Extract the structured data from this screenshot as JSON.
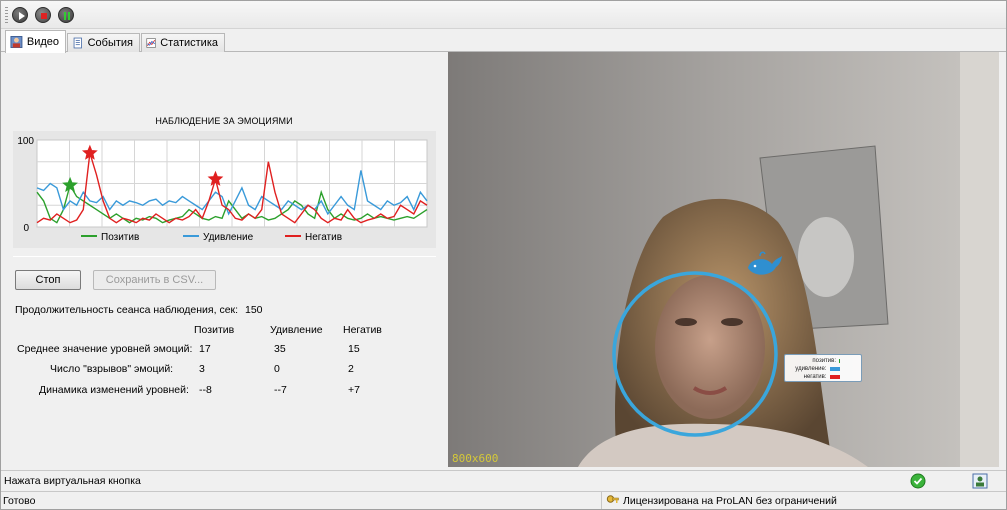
{
  "toolbar": {
    "buttons": [
      {
        "name": "play-button",
        "icon": "play-icon"
      },
      {
        "name": "stop-button",
        "icon": "stop-icon"
      },
      {
        "name": "pause-button",
        "icon": "pause-icon"
      }
    ]
  },
  "tabs": [
    {
      "label": "Видео",
      "icon": "person-icon",
      "active": true
    },
    {
      "label": "События",
      "icon": "document-icon",
      "active": false
    },
    {
      "label": "Статистика",
      "icon": "chart-icon",
      "active": false
    }
  ],
  "chart_data": {
    "type": "line",
    "title": "НАБЛЮДЕНИЕ ЗА ЭМОЦИЯМИ",
    "ylim": [
      0,
      100
    ],
    "yticks": [
      "100",
      "0"
    ],
    "grid": true,
    "legend_position": "bottom",
    "x": [
      0,
      1,
      2,
      3,
      4,
      5,
      6,
      7,
      8,
      9,
      10,
      11,
      12,
      13,
      14,
      15,
      16,
      17,
      18,
      19,
      20,
      21,
      22,
      23,
      24,
      25,
      26,
      27,
      28,
      29,
      30,
      31,
      32,
      33,
      34,
      35,
      36,
      37,
      38,
      39,
      40,
      41,
      42,
      43,
      44,
      45,
      46,
      47,
      48,
      49,
      50,
      51,
      52,
      53,
      54,
      55,
      56,
      57,
      58,
      59
    ],
    "series": [
      {
        "name": "Позитив",
        "color": "#2ca02c",
        "values": [
          40,
          30,
          10,
          5,
          20,
          48,
          35,
          30,
          25,
          20,
          15,
          10,
          15,
          10,
          5,
          10,
          8,
          12,
          10,
          5,
          8,
          10,
          12,
          20,
          15,
          10,
          8,
          12,
          10,
          30,
          20,
          10,
          15,
          10,
          12,
          8,
          10,
          15,
          20,
          30,
          25,
          15,
          10,
          40,
          20,
          10,
          15,
          10,
          8,
          10,
          15,
          10,
          12,
          10,
          8,
          10,
          12,
          10,
          15,
          20
        ]
      },
      {
        "name": "Удивление",
        "color": "#3a9ad9",
        "values": [
          45,
          42,
          50,
          45,
          20,
          30,
          25,
          40,
          30,
          28,
          35,
          20,
          30,
          25,
          30,
          28,
          25,
          30,
          32,
          25,
          30,
          28,
          35,
          30,
          25,
          20,
          30,
          40,
          35,
          15,
          30,
          45,
          25,
          20,
          35,
          30,
          25,
          20,
          30,
          25,
          20,
          25,
          20,
          30,
          15,
          25,
          35,
          25,
          20,
          65,
          30,
          25,
          20,
          30,
          25,
          28,
          35,
          20,
          40,
          30
        ]
      },
      {
        "name": "Негатив",
        "color": "#e02020",
        "values": [
          5,
          10,
          8,
          15,
          10,
          5,
          8,
          20,
          85,
          60,
          30,
          10,
          5,
          10,
          8,
          5,
          10,
          8,
          15,
          10,
          5,
          10,
          8,
          12,
          20,
          10,
          30,
          55,
          25,
          20,
          10,
          8,
          15,
          10,
          20,
          75,
          40,
          15,
          10,
          5,
          15,
          25,
          20,
          10,
          5,
          10,
          8,
          20,
          10,
          5,
          8,
          10,
          15,
          10,
          12,
          25,
          20,
          15,
          30,
          25
        ]
      }
    ],
    "markers": [
      {
        "series": "Позитив",
        "index": 5,
        "value": 48
      },
      {
        "series": "Негатив",
        "index": 8,
        "value": 85
      },
      {
        "series": "Негатив",
        "index": 27,
        "value": 55
      }
    ]
  },
  "controls": {
    "stop_label": "Стоп",
    "save_csv_label": "Сохранить в CSV..."
  },
  "session": {
    "duration_label": "Продолжительность сеанса наблюдения, сек:",
    "duration_value": "150"
  },
  "stats": {
    "headers": [
      "Позитив",
      "Удивление",
      "Негатив"
    ],
    "rows": [
      {
        "label": "Среднее значение уровней эмоций:",
        "values": [
          "17",
          "35",
          "15"
        ]
      },
      {
        "label": "Число \"взрывов\" эмоций:",
        "values": [
          "3",
          "0",
          "2"
        ]
      },
      {
        "label": "Динамика изменений уровней:",
        "values": [
          "--8",
          "--7",
          "+7"
        ]
      }
    ]
  },
  "video": {
    "resolution_label": "800x600",
    "overlay": {
      "rows": [
        {
          "label": "позитив:",
          "color": "#2ca02c",
          "width": 0.02
        },
        {
          "label": "удивление:",
          "color": "#3a9ad9",
          "width": 0.35
        },
        {
          "label": "негатив:",
          "color": "#e02020",
          "width": 0.35
        }
      ]
    },
    "face_circle_color": "#3aa6dc"
  },
  "status": {
    "message": "Нажата виртуальная кнопка",
    "ready": "Готово",
    "license": "Лицензирована на ProLAN без ограничений"
  }
}
